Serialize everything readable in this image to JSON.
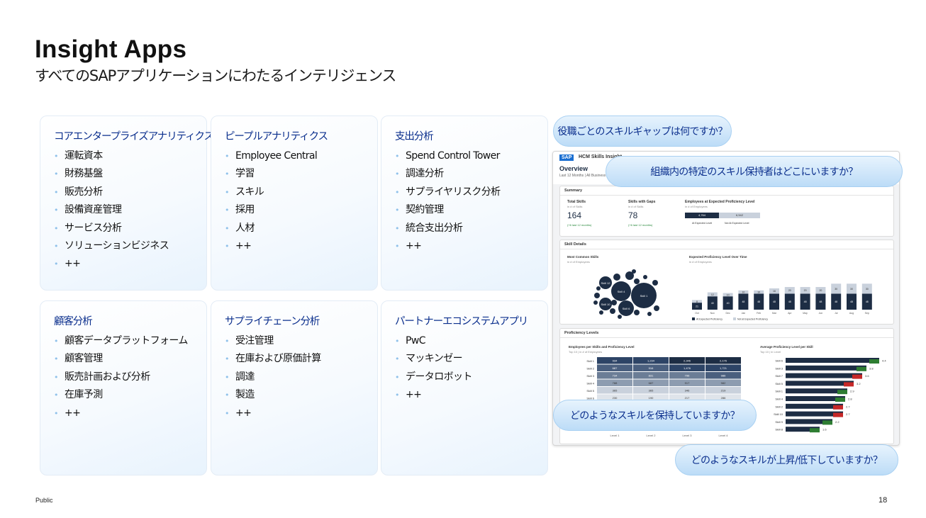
{
  "title": "Insight Apps",
  "subtitle": "すべてのSAPアプリケーションにわたるインテリジェンス",
  "cards": [
    {
      "title": "コアエンタープライズアナリティクス",
      "items": [
        "運転資本",
        "財務基盤",
        "販売分析",
        "設備資産管理",
        "サービス分析",
        "ソリューションビジネス",
        "++"
      ]
    },
    {
      "title": "ピープルアナリティクス",
      "items": [
        "Employee Central",
        "学習",
        "スキル",
        "採用",
        "人材",
        "++"
      ]
    },
    {
      "title": "支出分析",
      "items": [
        "Spend Control Tower",
        "調達分析",
        "サプライヤリスク分析",
        "契約管理",
        "統合支出分析",
        "++"
      ]
    },
    {
      "title": "顧客分析",
      "items": [
        "顧客データプラットフォーム",
        "顧客管理",
        "販売計画および分析",
        "在庫予測",
        "++"
      ]
    },
    {
      "title": "サプライチェーン分析",
      "items": [
        "受注管理",
        "在庫および原価計算",
        "調達",
        "製造",
        "++"
      ]
    },
    {
      "title": "パートナーエコシステムアプリ",
      "items": [
        "PwC",
        "マッキンゼー",
        "データロボット",
        "++"
      ]
    }
  ],
  "bullet": "•",
  "bubbles": {
    "q1": "役職ごとのスキルギャップは何ですか？",
    "q2": "組織内の特定のスキル保持者はどこにいますか？",
    "q3": "どのようなスキルを保持していますか？",
    "q4": "どのようなスキルが上昇/低下していますか？"
  },
  "screenshot": {
    "logo": "SAP",
    "app_title": "HCM Skills Insight",
    "overview": "Overview",
    "overview_sub": "Last 12 Months | All Business Units",
    "summary": "Summary",
    "total_skills_label": "Total Skills",
    "total_skills_sub": "in # of Skills",
    "total_skills_value": "164",
    "total_skills_change": "(+6 last 12 months)",
    "gaps_label": "Skills with Gaps",
    "gaps_sub": "in # of Skills",
    "gaps_value": "78",
    "gaps_change": "(+6 last 12 months)",
    "employees_label": "Employees at Expected Proficiency Level",
    "employees_sub": "in # of Employees",
    "at_level": "4,764",
    "not_at_level": "6,542",
    "legend_at": "At Expected Level",
    "legend_not": "Not At Expected Level",
    "skill_details": "Skill Details",
    "most_common": "Most Common Skills",
    "most_common_sub": "in # of Employees",
    "bubble_labels": [
      "Skill 1",
      "Skill 4",
      "Skill 12",
      "Skill 10",
      "Skill 6"
    ],
    "expected_label": "Expected Proficiency Level Over Time",
    "expected_sub": "in # of Employees",
    "months": [
      "Oct",
      "Nov",
      "Dec",
      "Jan",
      "Feb",
      "Mar",
      "Apr",
      "May",
      "Jun",
      "Jul",
      "Aug",
      "Sep"
    ],
    "bar_bottom": [
      "21",
      "40",
      "40",
      "48",
      "48",
      "48",
      "48",
      "48",
      "48",
      "48",
      "48",
      "48"
    ],
    "bar_top": [
      "8",
      "12",
      "10",
      "10",
      "10",
      "16",
      "20",
      "20",
      "20",
      "30",
      "30",
      "30"
    ],
    "legend_expected": "At Expected Proficiency",
    "legend_not_expected": "Not at Expected Proficiency",
    "proficiency": "Proficiency Levels",
    "heat_title": "Employees per Skills and Proficiency Level",
    "heat_sub": "Top 10 | in # of Employees",
    "heat_rows": [
      "Skill 1",
      "Skill 2",
      "Skill 3",
      "Skill 4",
      "Skill 5",
      "Skill 6"
    ],
    "heat_values": [
      [
        "934",
        "1,234",
        "2,346",
        "2,176"
      ],
      [
        "687",
        "916",
        "1,476",
        "1,721"
      ],
      [
        "734",
        "831",
        "796",
        "986"
      ],
      [
        "788",
        "687",
        "917",
        "982"
      ],
      [
        "365",
        "365",
        "346",
        "219"
      ],
      [
        "230",
        "190",
        "217",
        "286"
      ]
    ],
    "heat_cols": [
      "Level 1",
      "Level 2",
      "Level 3",
      "Level 4"
    ],
    "avg_title": "Average Proficiency Level per Skill",
    "avg_sub": "Top 10 | in Level",
    "avg_rows": [
      "Skill 6",
      "Skill 3",
      "Skill 7",
      "Skill 5",
      "Skill 1",
      "Skill 4",
      "Skill 2",
      "Skill 10",
      "Skill 9",
      "Skill 8"
    ],
    "avg_values": [
      "4.4",
      "3.8",
      "3.6",
      "3.2",
      "2.9",
      "2.8",
      "2.7",
      "2.7",
      "2.2",
      "1.6"
    ]
  },
  "footer": {
    "classification": "Public",
    "page": "18"
  },
  "colors": {
    "heading": "#0b2f8d",
    "bullet": "#8fc1ea",
    "navy": "#1d2d44",
    "light_bar": "#c9d1dc"
  }
}
